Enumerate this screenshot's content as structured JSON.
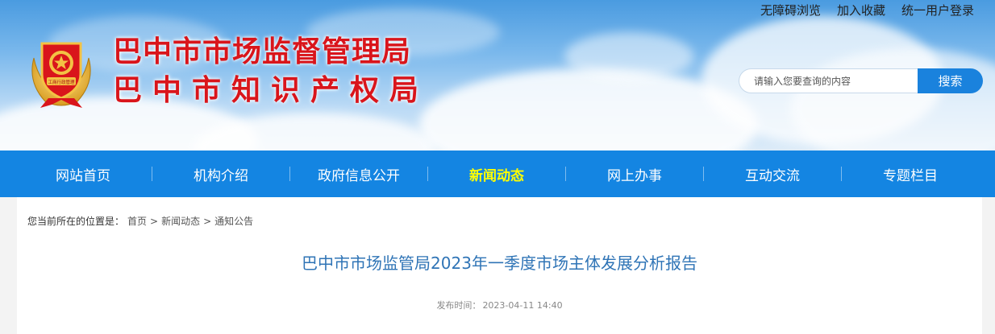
{
  "header": {
    "title_line1": "巴中市市场监督管理局",
    "title_line2": "巴中市知识产权局",
    "emblem_text": "工商行政管理",
    "top_links": [
      "无障碍浏览",
      "加入收藏",
      "统一用户登录"
    ],
    "search": {
      "placeholder": "请输入您要查询的内容",
      "button_label": "搜索"
    }
  },
  "nav": {
    "items": [
      {
        "label": "网站首页",
        "active": false
      },
      {
        "label": "机构介绍",
        "active": false
      },
      {
        "label": "政府信息公开",
        "active": false
      },
      {
        "label": "新闻动态",
        "active": true
      },
      {
        "label": "网上办事",
        "active": false
      },
      {
        "label": "互动交流",
        "active": false
      },
      {
        "label": "专题栏目",
        "active": false
      }
    ],
    "active_color": "#ffff00",
    "background": "#1485e2"
  },
  "breadcrumb": {
    "prefix": "您当前所在的位置是：",
    "items": [
      "首页",
      "新闻动态",
      "通知公告"
    ],
    "separator": ">"
  },
  "article": {
    "title": "巴中市市场监管局2023年一季度市场主体发展分析报告",
    "publish_label": "发布时间：",
    "publish_time": "2023-04-11 14:40"
  },
  "colors": {
    "title_red": "#d9151b",
    "article_title_blue": "#2f74b6",
    "search_button": "#1a82dd"
  }
}
